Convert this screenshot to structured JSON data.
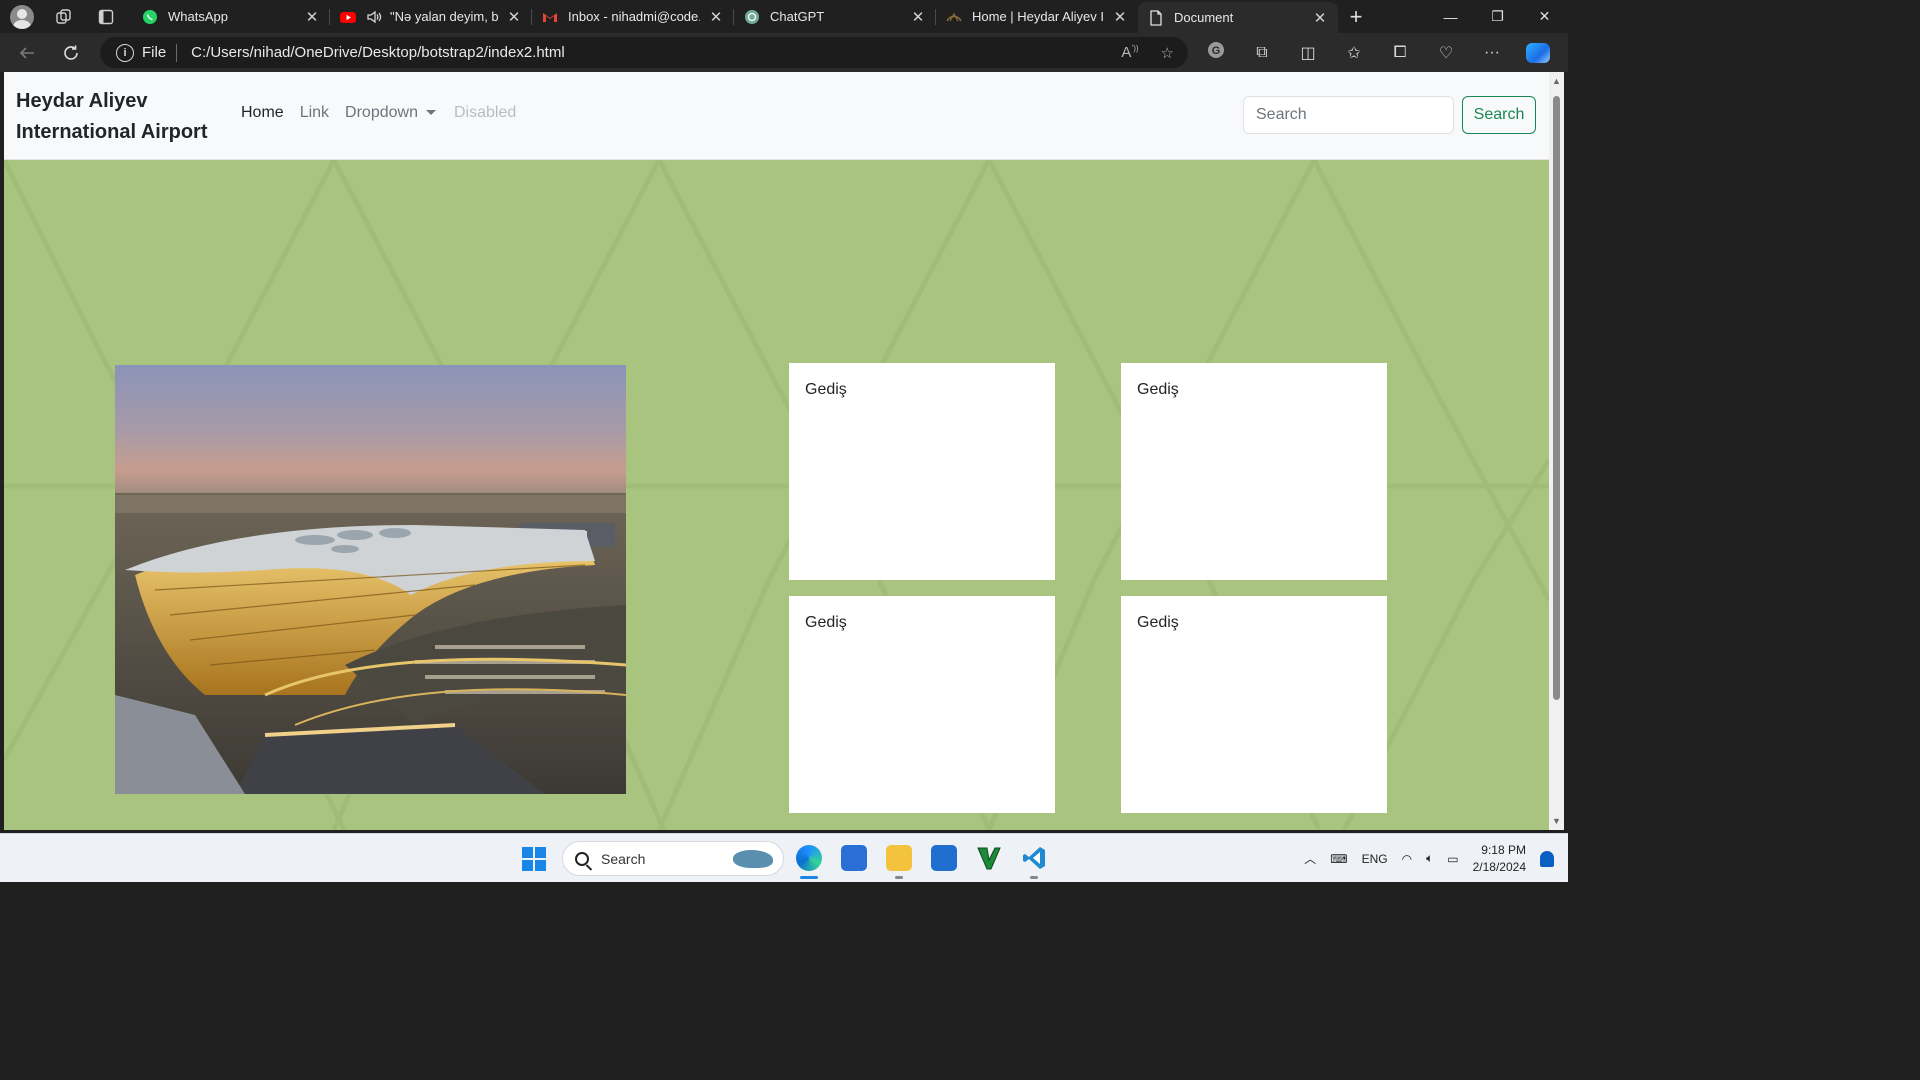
{
  "browser": {
    "tabs": [
      {
        "title": "WhatsApp",
        "icon": "whatsapp-icon"
      },
      {
        "title": "\"Nə yalan deyim, ba",
        "icon": "youtube-icon",
        "audio": true
      },
      {
        "title": "Inbox - nihadmi@code.e",
        "icon": "gmail-icon"
      },
      {
        "title": "ChatGPT",
        "icon": "chatgpt-icon"
      },
      {
        "title": "Home | Heydar Aliyev Int",
        "icon": "airport-icon"
      },
      {
        "title": "Document",
        "icon": "document-icon",
        "active": true
      }
    ],
    "url_scheme": "File",
    "url": "C:/Users/nihad/OneDrive/Desktop/botstrap2/index2.html"
  },
  "page": {
    "brand_line1": "Heydar Aliyev",
    "brand_line2": "International Airport",
    "nav": {
      "home": "Home",
      "link": "Link",
      "dropdown": "Dropdown",
      "disabled": "Disabled"
    },
    "search_placeholder": "Search",
    "search_button": "Search",
    "cards": [
      "Gediş",
      "Gediş",
      "Gediş",
      "Gediş"
    ],
    "colors": {
      "background": "#a8c47f",
      "navbar": "#f8f9fa",
      "search_button": "#198754"
    }
  },
  "taskbar": {
    "search_label": "Search",
    "language": "ENG",
    "time": "9:18 PM",
    "date": "2/18/2024"
  }
}
